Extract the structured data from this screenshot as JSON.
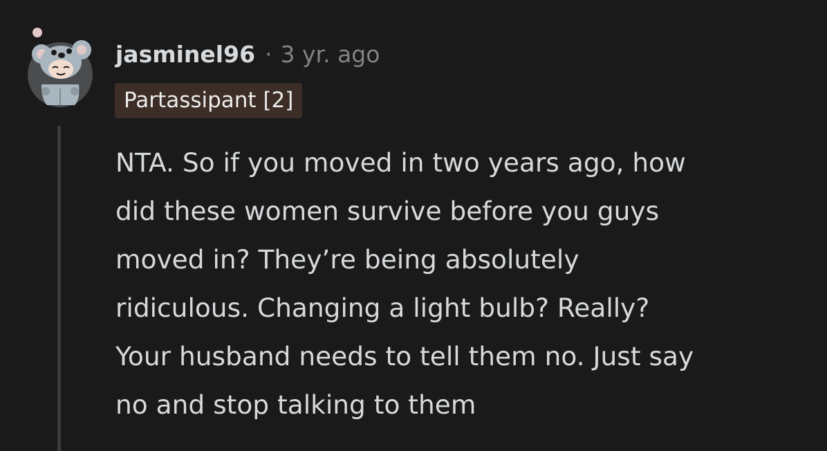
{
  "comment": {
    "author": "jasminel96",
    "separator": "·",
    "timestamp": "3 yr. ago",
    "flair": "Partassipant [2]",
    "lines": [
      "NTA. So if you moved in two years ago, how",
      "did these women survive before you guys",
      "moved in? They’re being absolutely",
      "ridiculous. Changing a light bulb? Really?",
      "Your husband needs to tell them no. Just say",
      "no and stop talking to them"
    ]
  },
  "colors": {
    "background": "#1a1a1b",
    "text": "#d7dadc",
    "meta": "#818384",
    "flair_bg": "#3c2e26",
    "thread_line": "#3a3b3c"
  },
  "icons": {
    "avatar": "koala-costume-avatar-icon"
  }
}
